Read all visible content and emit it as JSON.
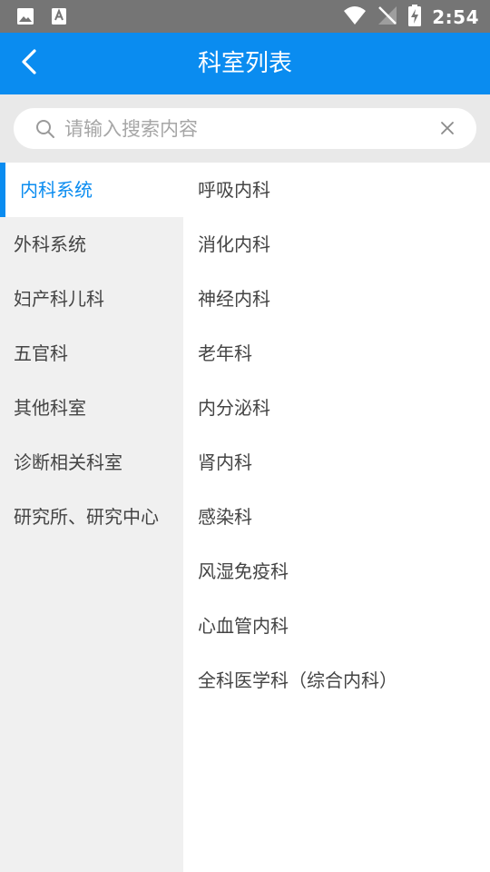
{
  "status_bar": {
    "time": "2:54",
    "icons": [
      "image-icon",
      "text-a-icon",
      "wifi-icon",
      "no-signal-icon",
      "battery-charging-icon"
    ]
  },
  "header": {
    "title": "科室列表",
    "back_icon": "chevron-left-icon"
  },
  "search": {
    "placeholder": "请输入搜索内容",
    "value": ""
  },
  "categories": [
    {
      "label": "内科系统",
      "active": true
    },
    {
      "label": "外科系统",
      "active": false
    },
    {
      "label": "妇产科儿科",
      "active": false
    },
    {
      "label": "五官科",
      "active": false
    },
    {
      "label": "其他科室",
      "active": false
    },
    {
      "label": "诊断相关科室",
      "active": false
    },
    {
      "label": "研究所、研究中心",
      "active": false
    }
  ],
  "departments": [
    "呼吸内科",
    "消化内科",
    "神经内科",
    "老年科",
    "内分泌科",
    "肾内科",
    "感染科",
    "风湿免疫科",
    "心血管内科",
    "全科医学科（综合内科）"
  ],
  "colors": {
    "accent": "#0a8cf0",
    "status_bar": "#757575",
    "panel_bg": "#f0f0f0",
    "text": "#444444"
  }
}
